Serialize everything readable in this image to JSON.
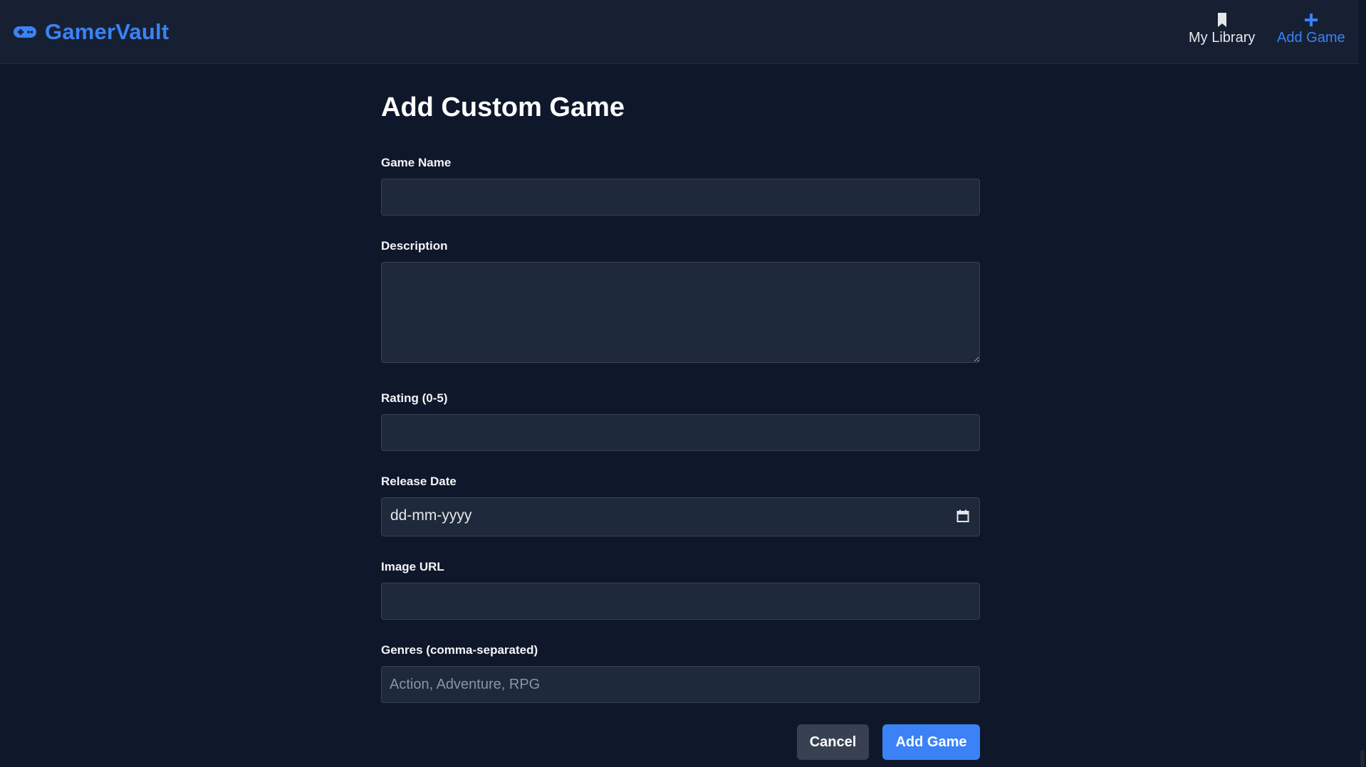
{
  "navbar": {
    "brand": "GamerVault",
    "brand_icon": "gamepad-icon",
    "links": [
      {
        "label": "My Library",
        "icon": "bookmark-icon",
        "color": "#e5e7eb"
      },
      {
        "label": "Add Game",
        "icon": "plus-icon",
        "color": "#3b82f6",
        "active": true
      }
    ]
  },
  "form": {
    "title": "Add Custom Game",
    "fields": {
      "game_name": {
        "label": "Game Name",
        "value": "",
        "placeholder": ""
      },
      "description": {
        "label": "Description",
        "value": "",
        "placeholder": ""
      },
      "rating": {
        "label": "Rating (0-5)",
        "value": "",
        "placeholder": ""
      },
      "release_date": {
        "label": "Release Date",
        "display": "dd-mm-yyyy",
        "icon": "calendar-icon"
      },
      "image_url": {
        "label": "Image URL",
        "value": "",
        "placeholder": ""
      },
      "genres": {
        "label": "Genres (comma-separated)",
        "value": "",
        "placeholder": "Action, Adventure, RPG"
      }
    },
    "buttons": {
      "cancel": "Cancel",
      "submit": "Add Game"
    }
  },
  "colors": {
    "background": "#0f172a",
    "navbar": "#172033",
    "accent": "#3b82f6",
    "field_bg": "#1e293b",
    "cancel_bg": "#374151"
  }
}
